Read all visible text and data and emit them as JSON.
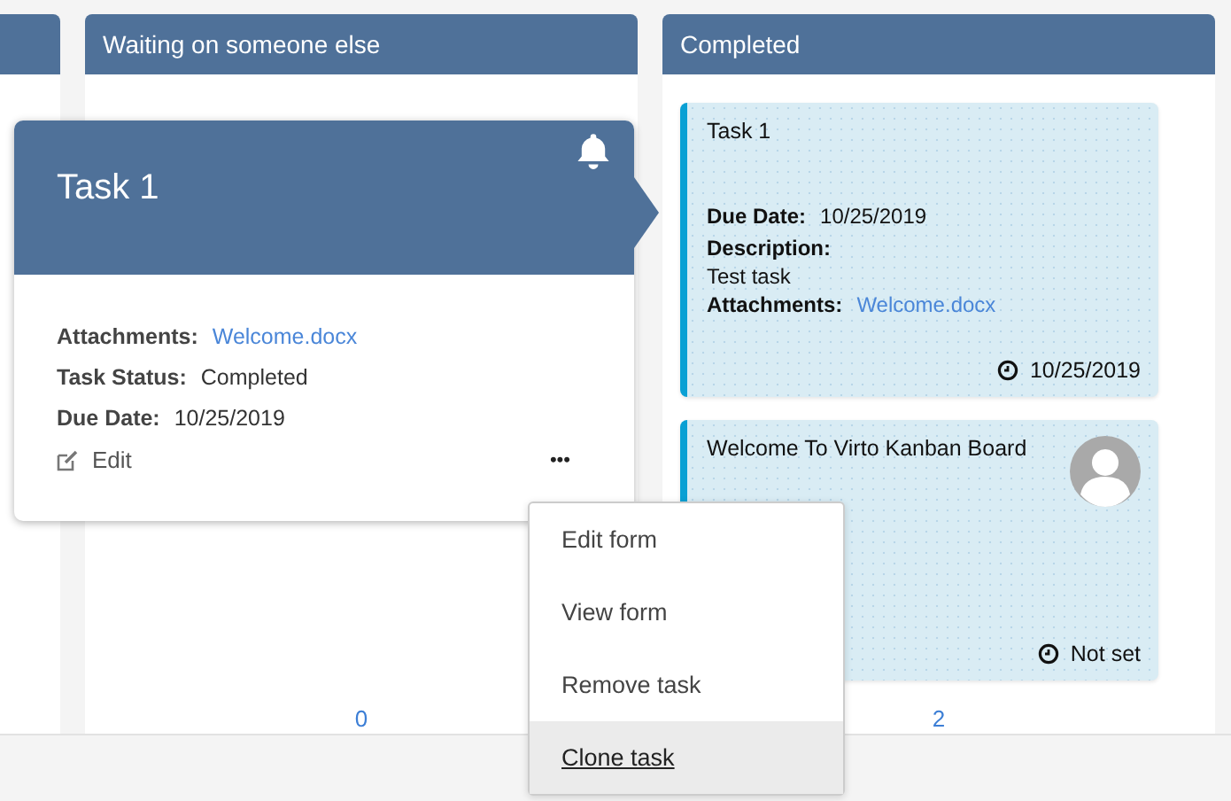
{
  "columns": [
    {
      "title": "Waiting on someone else",
      "count": "0"
    },
    {
      "title": "Completed",
      "count": "2",
      "cards": [
        {
          "title": "Task 1",
          "kind": "details",
          "fields": [
            {
              "label": "Due Date:",
              "value": "10/25/2019",
              "kind": "text"
            },
            {
              "label": "Description:",
              "value": "Test task",
              "kind": "block"
            },
            {
              "label": "Attachments:",
              "value": "Welcome.docx",
              "kind": "link"
            }
          ],
          "due": "10/25/2019"
        },
        {
          "title": "Welcome To Virto Kanban Board",
          "kind": "avatar",
          "due": "Not set"
        }
      ]
    }
  ],
  "popup": {
    "title": "Task 1",
    "fields": [
      {
        "label": "Attachments:",
        "value": "Welcome.docx",
        "kind": "link"
      },
      {
        "label": "Task Status:",
        "value": "Completed",
        "kind": "text"
      },
      {
        "label": "Due Date:",
        "value": "10/25/2019",
        "kind": "text"
      }
    ],
    "edit": "Edit",
    "more": "•••"
  },
  "menu": [
    {
      "label": "Edit form",
      "selected": false
    },
    {
      "label": "View form",
      "selected": false
    },
    {
      "label": "Remove task",
      "selected": false
    },
    {
      "label": "Clone task",
      "selected": true
    }
  ]
}
